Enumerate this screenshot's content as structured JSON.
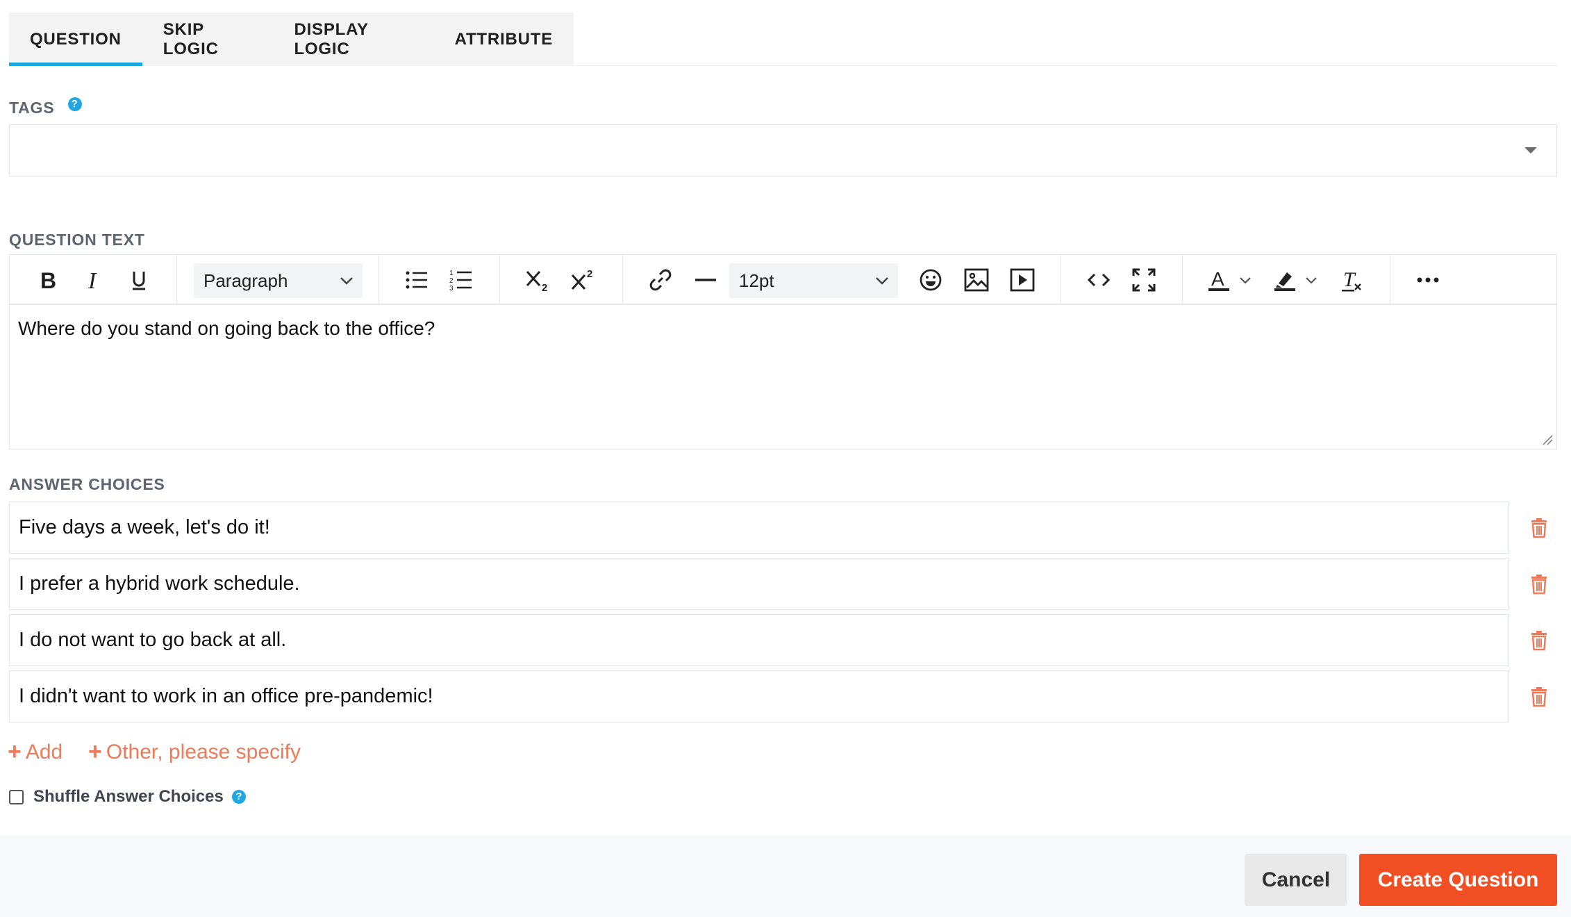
{
  "tabs": [
    {
      "label": "QUESTION",
      "active": true
    },
    {
      "label": "SKIP LOGIC",
      "active": false
    },
    {
      "label": "DISPLAY LOGIC",
      "active": false
    },
    {
      "label": "ATTRIBUTE",
      "active": false
    }
  ],
  "tags": {
    "label": "TAGS",
    "help_glyph": "?",
    "value": ""
  },
  "question_text": {
    "label": "QUESTION TEXT",
    "block_format": "Paragraph",
    "font_size": "12pt",
    "content": "Where do you stand on going back to the office?"
  },
  "answers": {
    "label": "ANSWER CHOICES",
    "choices": [
      "Five days a week, let's do it!",
      "I prefer a hybrid work schedule.",
      "I do not want to go back at all.",
      "I didn't want to work in an office pre-pandemic!"
    ],
    "add_label": "Add",
    "other_label": "Other, please specify",
    "shuffle_label": "Shuffle Answer Choices",
    "shuffle_checked": false
  },
  "footer": {
    "cancel_label": "Cancel",
    "create_label": "Create Question"
  },
  "colors": {
    "accent": "#1ea7e1",
    "primary_button": "#f04e23",
    "link": "#ee7a5a",
    "trash": "#ee7a5a"
  }
}
